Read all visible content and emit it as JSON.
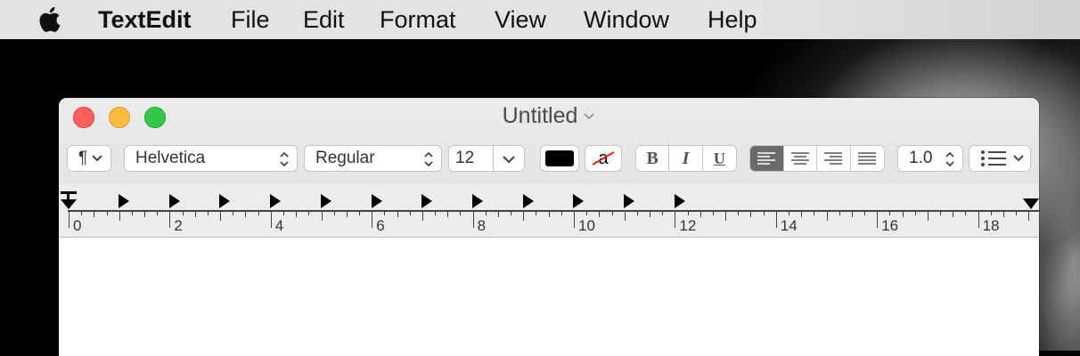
{
  "menubar": {
    "app_name": "TextEdit",
    "items": [
      "File",
      "Edit",
      "Format",
      "View",
      "Window",
      "Help"
    ]
  },
  "window": {
    "title": "Untitled",
    "toolbar": {
      "paragraph_symbol": "¶",
      "font_family": "Helvetica",
      "font_style": "Regular",
      "font_size": "12",
      "text_color": "#000000",
      "highlight_glyph": "a",
      "bold_label": "B",
      "italic_label": "I",
      "underline_label": "U",
      "line_spacing": "1.0"
    },
    "ruler": {
      "numbers": [
        "0",
        "2",
        "4",
        "6",
        "8",
        "10",
        "12",
        "14",
        "16",
        "18"
      ]
    }
  }
}
